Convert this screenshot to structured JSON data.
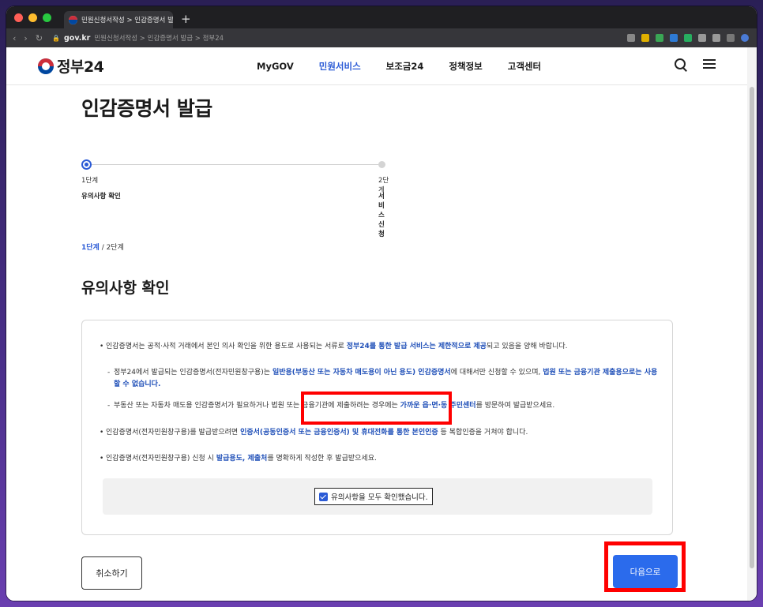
{
  "browser": {
    "tab_title": "민원신청서작성 > 인감증명서 발급",
    "tab_close": "×",
    "new_tab": "+",
    "url_domain": "gov.kr",
    "url_path": "민원신청서작성 > 인감증명서 발급 > 정부24",
    "nav_back": "‹",
    "nav_forward": "›",
    "nav_reload": "↻"
  },
  "header": {
    "logo_text": "정부24",
    "nav": [
      "MyGOV",
      "민원서비스",
      "보조금24",
      "정책정보",
      "고객센터"
    ],
    "active_nav": "민원서비스"
  },
  "page": {
    "title": "인감증명서 발급",
    "steps": [
      {
        "num": "1단계",
        "name": "유의사항 확인"
      },
      {
        "num": "2단계",
        "name": "서비스 신청"
      }
    ],
    "breadcrumb_current": "1단계",
    "breadcrumb_rest": " / 2단계",
    "section_title": "유의사항 확인"
  },
  "notice": {
    "item1_a": "인감증명서는 공적·사적 거래에서 본인 의사 확인을 위한 용도로 사용되는 서류로 ",
    "item1_hl": "정부24를 통한 발급 서비스는 제한적으로 제공",
    "item1_b": "되고 있음을 양해 바랍니다.",
    "sub1_a": "정부24에서 발급되는 인감증명서(전자민원창구용)는 ",
    "sub1_hl1": "일반용(부동산 또는 자동차 매도용이 아닌 용도) 인감증명서",
    "sub1_b": "에 대해서만 신청할 수 있으며, ",
    "sub1_hl2": "법원 또는 금융기관 제출용으로는 사용할 수 없습니다.",
    "sub2_a": "부동산 또는 자동차 매도용 인감증명서가 필요하거나 법원 또는 금융기관에 제출하려는 경우에는 ",
    "sub2_hl": "가까운 읍·면·동 주민센터",
    "sub2_b": "를 방문하여 발급받으세요.",
    "item2_a": "인감증명서(전자민원창구용)를 발급받으려면 ",
    "item2_hl": "인증서(공동인증서 또는 금융인증서) 및 휴대전화를 통한 본인인증",
    "item2_b": " 등 복합인증을 거쳐야 합니다.",
    "item3_a": "인감증명서(전자민원창구용) 신청 시 ",
    "item3_hl": "발급용도, 제출처",
    "item3_b": "를 명확하게 작성한 후 발급받으세요.",
    "confirm_label": "유의사항을 모두 확인했습니다.",
    "confirm_checked": true
  },
  "buttons": {
    "cancel": "취소하기",
    "next": "다음으로"
  },
  "colors": {
    "accent": "#2b5bd6",
    "primary_button": "#2b6bec",
    "highlight_box": "#ff0000"
  }
}
